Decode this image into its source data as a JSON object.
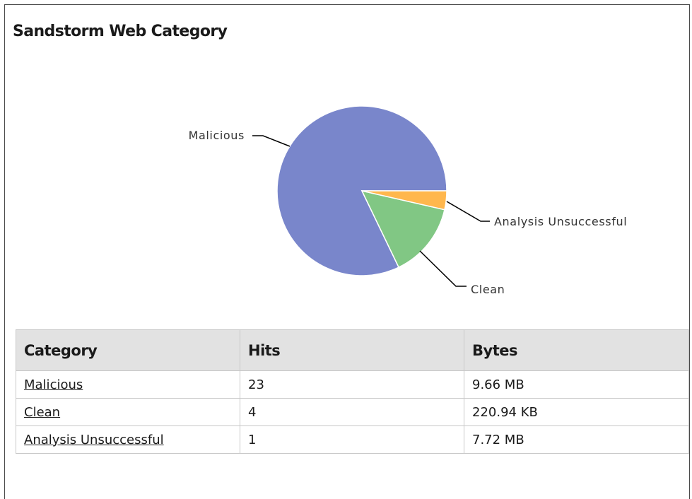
{
  "panel": {
    "title": "Sandstorm Web Category"
  },
  "colors": {
    "malicious": "#7986cb",
    "clean": "#81c784",
    "analysis_unsuccessful": "#ffb74d"
  },
  "chart_data": {
    "type": "pie",
    "slices": [
      {
        "label": "Malicious",
        "value": 23
      },
      {
        "label": "Clean",
        "value": 4
      },
      {
        "label": "Analysis Unsuccessful",
        "value": 1
      }
    ]
  },
  "table": {
    "headers": {
      "category": "Category",
      "hits": "Hits",
      "bytes": "Bytes"
    },
    "rows": [
      {
        "category": "Malicious",
        "hits": "23",
        "bytes": "9.66 MB"
      },
      {
        "category": "Clean",
        "hits": "4",
        "bytes": "220.94 KB"
      },
      {
        "category": "Analysis Unsuccessful",
        "hits": "1",
        "bytes": "7.72 MB"
      }
    ]
  }
}
